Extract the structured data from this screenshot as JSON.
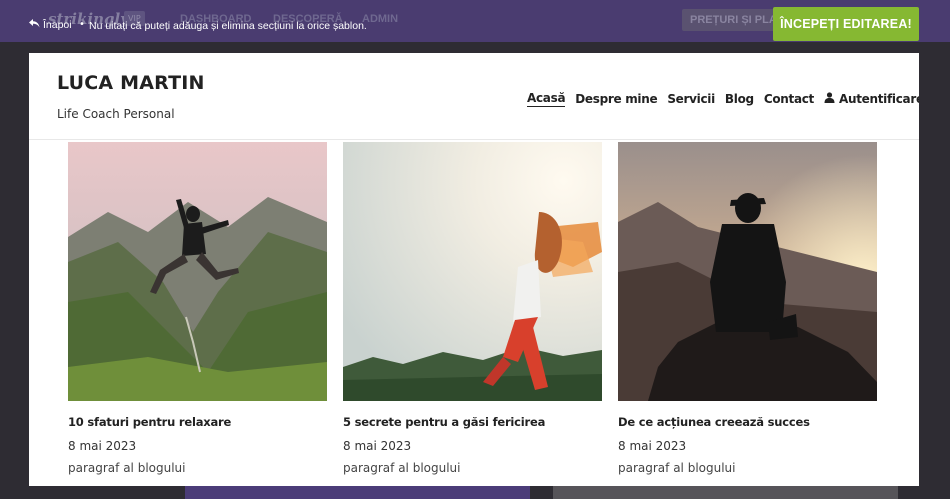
{
  "background_chrome": {
    "logo": "strikingly",
    "badge": "VIP",
    "nav": [
      "DASHBOARD",
      "DESCOPERĂ",
      "ADMIN"
    ],
    "pricing": "PREȚURI ȘI PLA"
  },
  "overlay": {
    "back_label": "Înapoi",
    "separator": "•",
    "hint": "Nu uitați că puteți adăuga și elimina secțiuni la orice șablon.",
    "start_button": "ÎNCEPEȚI EDITAREA!",
    "accent_color": "#86b832"
  },
  "site": {
    "title": "LUCA MARTIN",
    "tagline": "Life Coach Personal",
    "nav": {
      "home": "Acasă",
      "about": "Despre mine",
      "services": "Servicii",
      "blog": "Blog",
      "contact": "Contact",
      "login": "Autentificare"
    }
  },
  "posts": [
    {
      "title": "10 sfaturi pentru relaxare",
      "date": "8 mai 2023",
      "excerpt": "paragraf al blogului",
      "image": "mountain-jump-photo"
    },
    {
      "title": "5 secrete pentru a găsi fericirea",
      "date": "8 mai 2023",
      "excerpt": "paragraf al blogului",
      "image": "sunlight-dancer-photo"
    },
    {
      "title": "De ce acțiunea creează succes",
      "date": "8 mai 2023",
      "excerpt": "paragraf al blogului",
      "image": "sunset-summit-photo"
    }
  ]
}
